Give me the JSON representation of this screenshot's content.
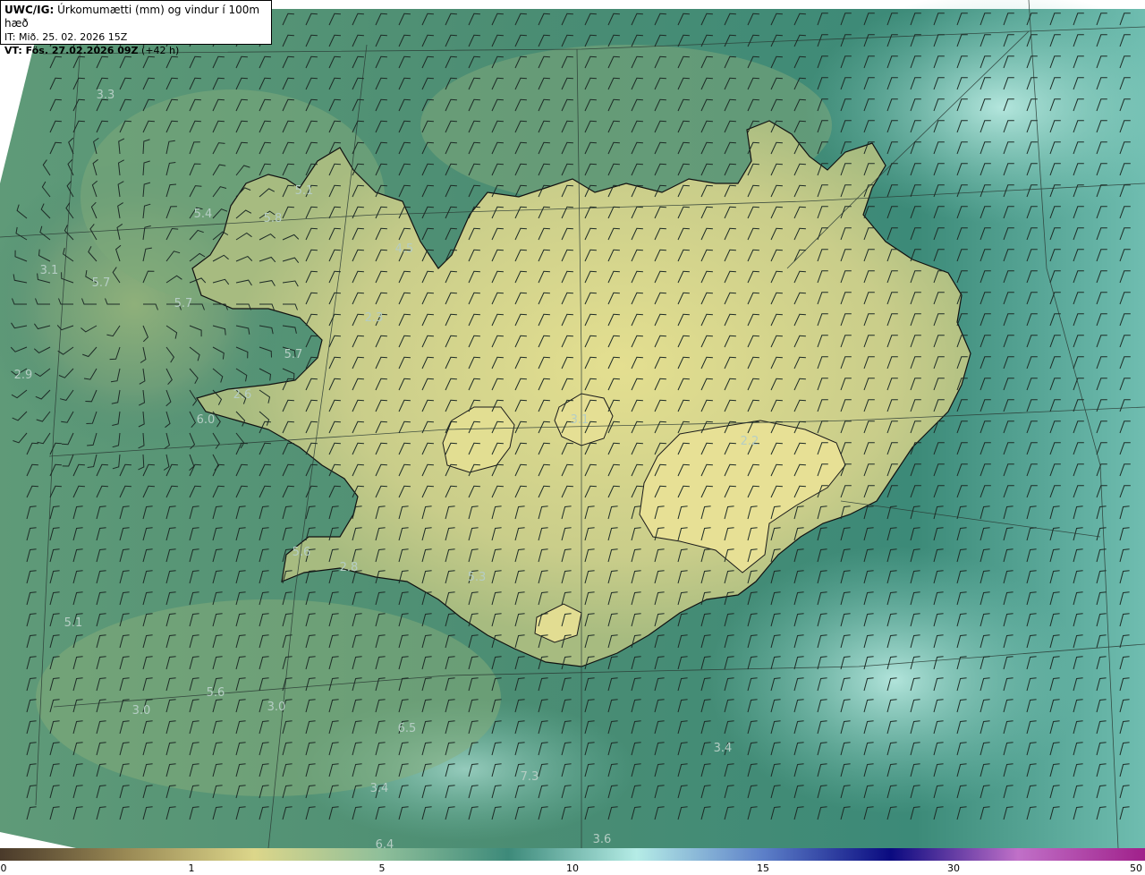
{
  "header": {
    "product": "UWC/IG:",
    "title": "Úrkomumætti (mm) og vindur í 100m hæð",
    "init_time": "IT: Mið. 25. 02. 2026 15Z",
    "valid_label": "VT: Fös. 27.02.2026 09Z",
    "lead": "(+42 h)"
  },
  "colorbar": {
    "ticks": [
      "0",
      "1",
      "5",
      "10",
      "15",
      "30",
      "50"
    ],
    "colors": [
      "#4a3a2a",
      "#9a8a55",
      "#dcd68a",
      "#8fbf9a",
      "#3d8a7a",
      "#b5ece6",
      "#5c7fc8",
      "#0a0a80",
      "#c070c8",
      "#a0208a"
    ]
  },
  "map_colors": {
    "sea_deep": "#2f7a6b",
    "sea_mid": "#5a9a78",
    "land_wet": "#b8c587",
    "land_dry": "#e1df8f",
    "coast": "#111111",
    "barb": "#1d2b26"
  },
  "value_labels": [
    "3.3",
    "5.1",
    "5.4",
    "5.8",
    "4.5",
    "3.1",
    "5.7",
    "5.7",
    "2.3",
    "5.7",
    "2.9",
    "2.6",
    "6.0",
    "3.1",
    "2.2",
    "5.6",
    "2.8",
    "5.3",
    "5.1",
    "5.6",
    "3.0",
    "3.0",
    "6.5",
    "3.4",
    "7.3",
    "3.4",
    "3.6",
    "6.4"
  ]
}
